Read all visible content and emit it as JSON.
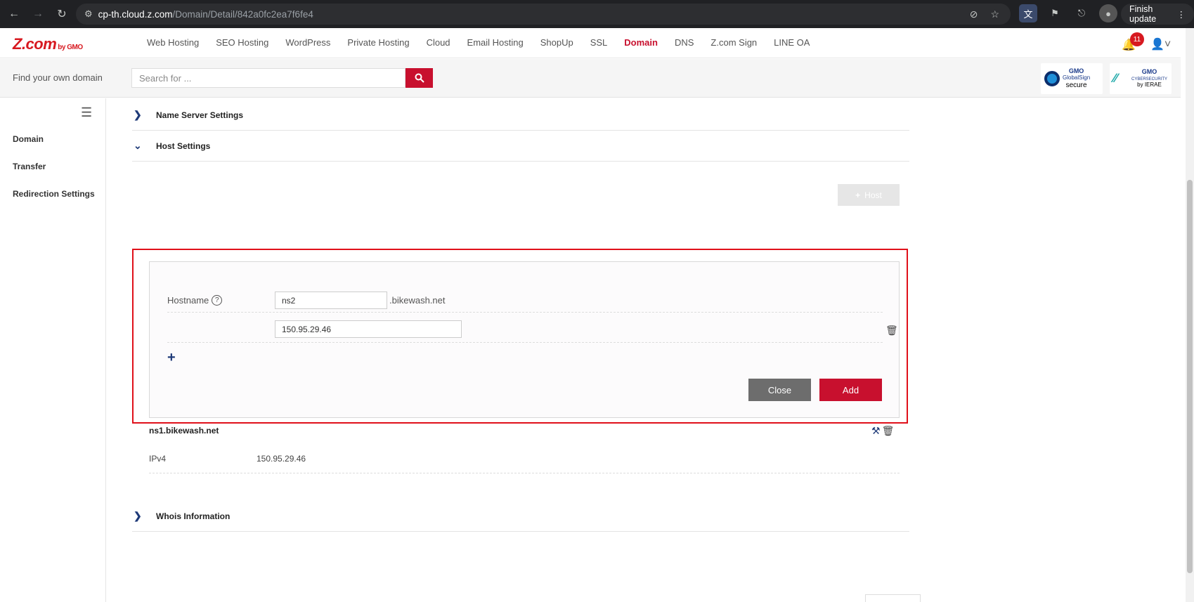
{
  "browser": {
    "url_host": "cp-th.cloud.z.com",
    "url_path": "/Domain/Detail/842a0fc2ea7f6fe4",
    "finish_update": "Finish update"
  },
  "brand": {
    "logo": "Z.com",
    "logo_suffix": "by GMO"
  },
  "nav": {
    "items": [
      "Web Hosting",
      "SEO Hosting",
      "WordPress",
      "Private Hosting",
      "Cloud",
      "Email Hosting",
      "ShopUp",
      "SSL",
      "Domain",
      "DNS",
      "Z.com Sign",
      "LINE OA"
    ],
    "active": "Domain",
    "notifications": "11"
  },
  "search": {
    "label": "Find your own domain",
    "placeholder": "Search for ..."
  },
  "seals": [
    {
      "line1": "GMO",
      "line2": "GlobalSign",
      "line3": "secure"
    },
    {
      "line1": "GMO",
      "line2": "CYBERSECURITY",
      "line3": "by IERAE"
    }
  ],
  "sidebar": {
    "items": [
      "Domain",
      "Transfer",
      "Redirection Settings"
    ]
  },
  "sections": {
    "name_server": "Name Server Settings",
    "host_settings": "Host Settings",
    "whois": "Whois Information"
  },
  "host_button": "Host",
  "form": {
    "hostname_label": "Hostname",
    "hostname_value": "ns2",
    "domain_suffix": ".bikewash.net",
    "ip_value": "150.95.29.46",
    "close_label": "Close",
    "add_label": "Add"
  },
  "host_entry": {
    "name": "ns1.bikewash.net",
    "type": "IPv4",
    "ip": "150.95.29.46"
  }
}
